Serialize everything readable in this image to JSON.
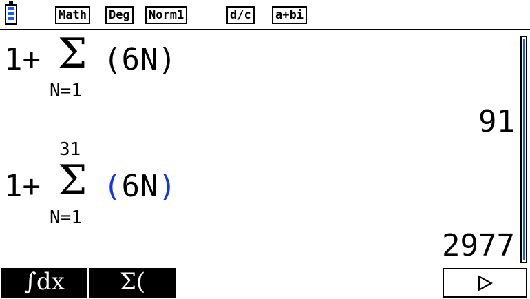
{
  "status_bar": {
    "battery_icon": "battery-icon",
    "badges": [
      "Math",
      "Deg",
      "Norm1",
      "d/c",
      "a+bi"
    ]
  },
  "history": [
    {
      "expression": {
        "lead": "1+",
        "sigma": "Σ",
        "upper_limit": "",
        "lower_limit": "N=1",
        "body_open": "(",
        "body_inner": "6N",
        "body_close": ")"
      },
      "result": "91"
    },
    {
      "expression": {
        "lead": "1+",
        "sigma": "Σ",
        "upper_limit": "31",
        "lower_limit": "N=1",
        "body_open": "(",
        "body_inner": "6N",
        "body_close": ")"
      },
      "result": "2977"
    }
  ],
  "function_keys": [
    {
      "label": "∫dx"
    },
    {
      "label": "Σ("
    },
    {
      "label": ""
    },
    {
      "label": ""
    },
    {
      "label": ""
    },
    {
      "label": "▷",
      "icon": "right-triangle-icon"
    }
  ],
  "colors": {
    "accent_blue": "#1133ee",
    "battery_blue": "#1a5cff"
  }
}
